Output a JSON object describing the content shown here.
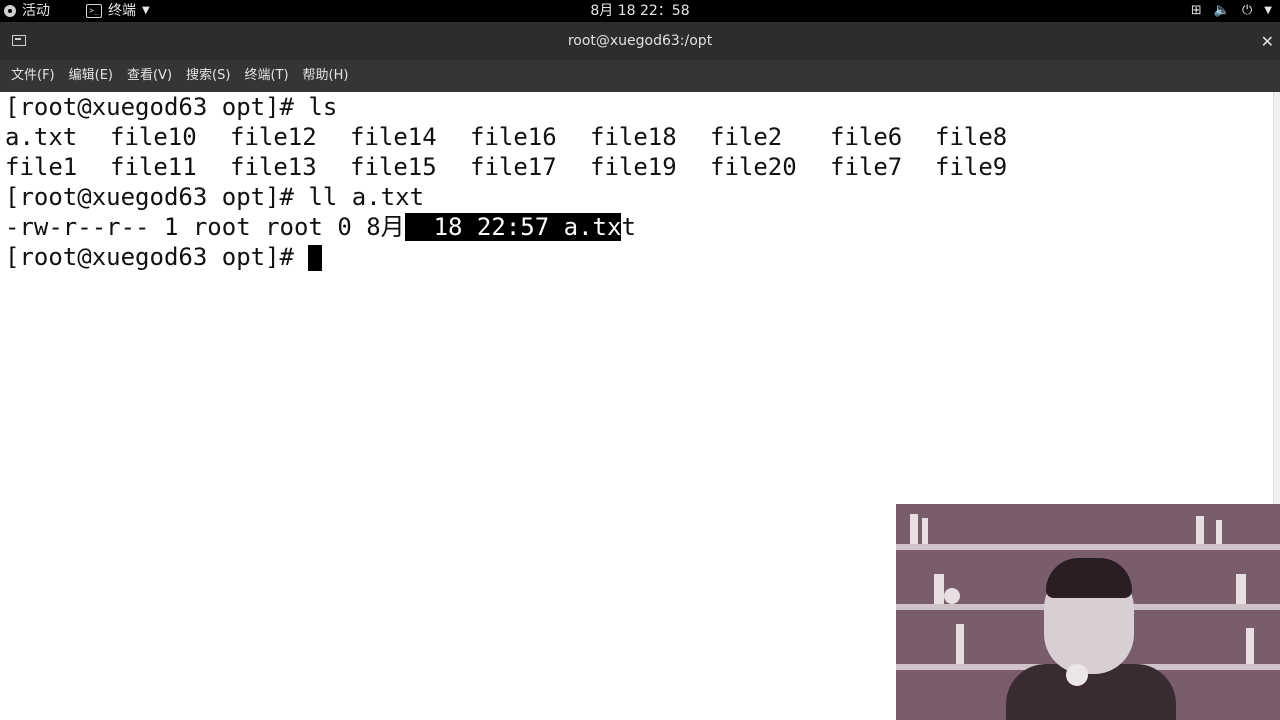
{
  "topbar": {
    "activities": "活动",
    "app_menu": "终端",
    "clock": "8月 18 22：58",
    "tray_icons": [
      "network-icon",
      "volume-icon",
      "power-icon"
    ]
  },
  "window": {
    "title": "root@xuegod63:/opt"
  },
  "menu": {
    "file": "文件(F)",
    "edit": "编辑(E)",
    "view": "查看(V)",
    "search": "搜索(S)",
    "terminal": "终端(T)",
    "help": "帮助(H)"
  },
  "terminal": {
    "line1": "[root@xuegod63 opt]# ls",
    "ls_row1": [
      "a.txt",
      "file10",
      "file12",
      "file14",
      "file16",
      "file18",
      "file2",
      "file6",
      "file8"
    ],
    "ls_row2": [
      "file1",
      "file11",
      "file13",
      "file15",
      "file17",
      "file19",
      "file20",
      "file7",
      "file9"
    ],
    "line4": "[root@xuegod63 opt]# ll a.txt",
    "ll_prefix": "-rw-r--r-- 1 root root 0 8月",
    "ll_selected": "  18 22:57 a.tx",
    "ll_suffix": "t",
    "prompt": "[root@xuegod63 opt]# "
  },
  "colors": {
    "topbar_bg": "#000000",
    "titlebar_bg": "#2d2d2d",
    "menubar_bg": "#353535",
    "terminal_bg": "#ffffff",
    "terminal_fg": "#111111",
    "selection_bg": "#000000"
  }
}
